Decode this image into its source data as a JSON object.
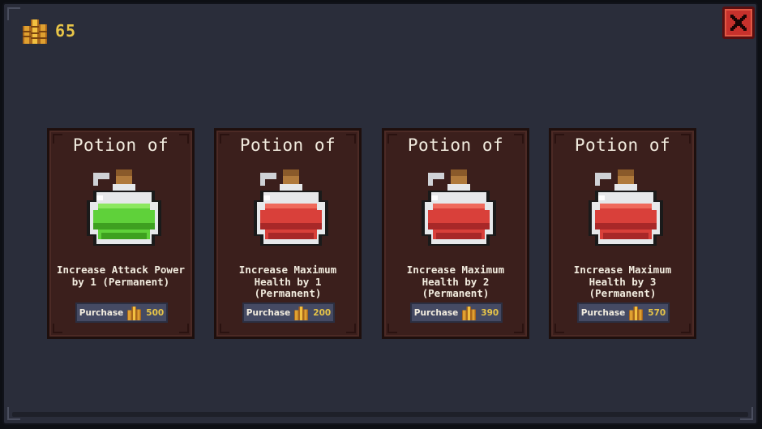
{
  "header": {
    "gold_amount": "65",
    "gold_icon": "coin-stack-icon",
    "close_icon": "close-x-icon"
  },
  "colors": {
    "background": "#2a2d3a",
    "card": "#3b1f1c",
    "gold_text": "#e8c548",
    "close_button": "#c7312c",
    "purchase_button": "#454a63",
    "potion_red": "#d9403a",
    "potion_green": "#5fd13a"
  },
  "shop": {
    "cards": [
      {
        "title": "Potion of",
        "description": "Increase Attack Power\nby 1 (Permanent)",
        "purchase_label": "Purchase",
        "price": "500",
        "potion_color": "green"
      },
      {
        "title": "Potion of",
        "description": "Increase Maximum\nHealth by 1\n(Permanent)",
        "purchase_label": "Purchase",
        "price": "200",
        "potion_color": "red"
      },
      {
        "title": "Potion of",
        "description": "Increase Maximum\nHealth by 2\n(Permanent)",
        "purchase_label": "Purchase",
        "price": "390",
        "potion_color": "red"
      },
      {
        "title": "Potion of",
        "description": "Increase Maximum\nHealth by 3\n(Permanent)",
        "purchase_label": "Purchase",
        "price": "570",
        "potion_color": "red"
      }
    ]
  }
}
